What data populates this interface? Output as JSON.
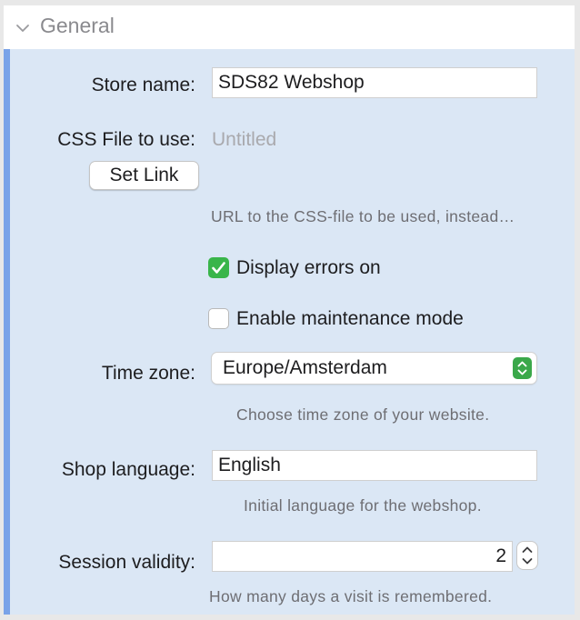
{
  "section": {
    "title": "General",
    "icon": "chevron-down-icon"
  },
  "store_name": {
    "label": "Store name:",
    "value": "SDS82 Webshop"
  },
  "css_file": {
    "label": "CSS File to use:",
    "value": "Untitled",
    "button_label": "Set Link",
    "hint": "URL to the CSS-file to be used, instead…"
  },
  "display_errors": {
    "label": "Display errors on",
    "checked": true
  },
  "maintenance": {
    "label": "Enable maintenance mode",
    "checked": false
  },
  "time_zone": {
    "label": "Time zone:",
    "value": "Europe/Amsterdam",
    "hint": "Choose time zone of your website."
  },
  "shop_language": {
    "label": "Shop language:",
    "value": "English",
    "hint": "Initial language for the webshop."
  },
  "session_validity": {
    "label": "Session validity:",
    "value": "2",
    "hint": "How many days a visit is remembered."
  },
  "colors": {
    "accent_stripe": "#7aa3e8",
    "content_background": "#dbe7f5",
    "checkbox_on": "#39b54a"
  }
}
